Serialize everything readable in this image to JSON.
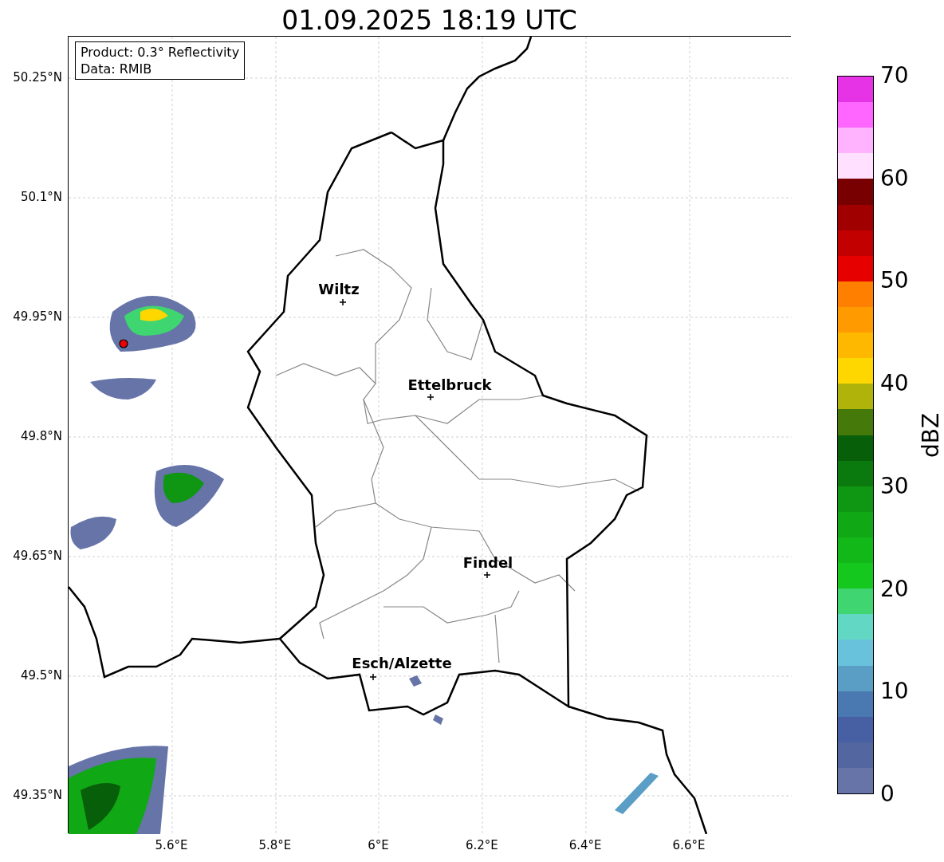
{
  "title": "01.09.2025 18:19 UTC",
  "info_box": [
    "Product: 0.3° Reflectivity",
    "Data: RMIB"
  ],
  "cities": [
    {
      "name": "Wiltz"
    },
    {
      "name": "Ettelbruck"
    },
    {
      "name": "Findel"
    },
    {
      "name": "Esch/Alzette"
    }
  ],
  "x_ticks": [
    "5.6°E",
    "5.8°E",
    "6°E",
    "6.2°E",
    "6.4°E",
    "6.6°E"
  ],
  "y_ticks": [
    "50.25°N",
    "50.1°N",
    "49.95°N",
    "49.8°N",
    "49.65°N",
    "49.5°N",
    "49.35°N"
  ],
  "colorbar": {
    "label": "dBZ",
    "ticks": [
      "70",
      "60",
      "50",
      "40",
      "30",
      "20",
      "10",
      "0"
    ],
    "segments": [
      {
        "color": "#6674a8"
      },
      {
        "color": "#5366a0"
      },
      {
        "color": "#4660a3"
      },
      {
        "color": "#4a78b0"
      },
      {
        "color": "#5a9ec6"
      },
      {
        "color": "#68c2dc"
      },
      {
        "color": "#62d8c4"
      },
      {
        "color": "#3fd570"
      },
      {
        "color": "#14c81e"
      },
      {
        "color": "#12b818"
      },
      {
        "color": "#11a815"
      },
      {
        "color": "#0f9612"
      },
      {
        "color": "#0b7a0e"
      },
      {
        "color": "#085f0a"
      },
      {
        "color": "#457a0a"
      },
      {
        "color": "#b0b40a"
      },
      {
        "color": "#ffd700"
      },
      {
        "color": "#ffb800"
      },
      {
        "color": "#ff9a00"
      },
      {
        "color": "#ff7f00"
      },
      {
        "color": "#e60000"
      },
      {
        "color": "#c30000"
      },
      {
        "color": "#a00000"
      },
      {
        "color": "#780000"
      },
      {
        "color": "#ffe0ff"
      },
      {
        "color": "#ffb3ff"
      },
      {
        "color": "#ff66ff"
      },
      {
        "color": "#e633e6"
      }
    ]
  }
}
